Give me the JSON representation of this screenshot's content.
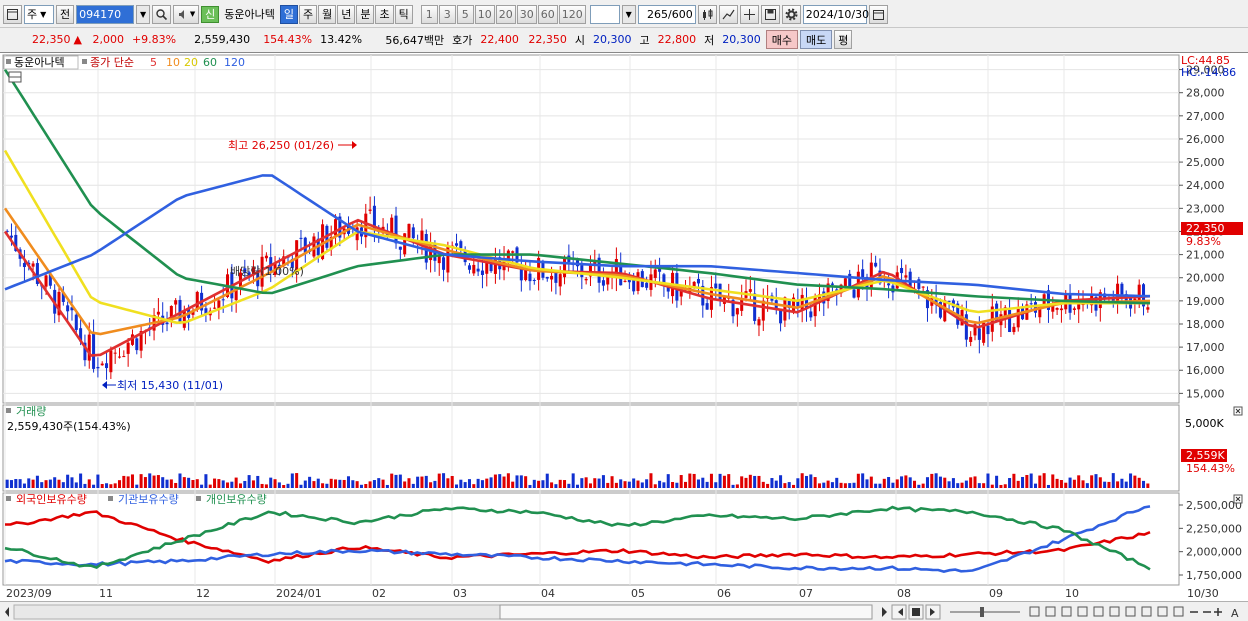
{
  "toolbar": {
    "period_type": "주",
    "prev_label": "전",
    "code": "094170",
    "new_badge": "신",
    "stock_name": "동운아나텍",
    "periods": [
      "일",
      "주",
      "월",
      "년",
      "분",
      "초",
      "틱"
    ],
    "active_period": "일",
    "minutes": [
      "1",
      "3",
      "5",
      "10",
      "20",
      "30",
      "60",
      "120"
    ],
    "count": "265",
    "count_total": "/600",
    "date": "2024/10/30"
  },
  "quote": {
    "price": "22,350",
    "change_arrow": "▲",
    "change": "2,000",
    "change_pct": "+9.83%",
    "volume": "2,559,430",
    "volume_ratio": "154.43%",
    "turnover": "13.42%",
    "trade_value": "56,647백만",
    "ask_label": "호가",
    "ask": "22,400",
    "bid": "22,350",
    "open_label": "시",
    "open": "20,300",
    "high_label": "고",
    "high": "22,800",
    "low_label": "저",
    "low": "20,300",
    "buy_label": "매수",
    "sell_label": "매도",
    "eval_label": "평"
  },
  "legend": {
    "stock": "동운아나텍",
    "ma_title": "종가 단순",
    "ma_periods": [
      "5",
      "10",
      "20",
      "60",
      "120"
    ],
    "lc": "LC:44.85",
    "hc": "HC:-14.86"
  },
  "annotations": {
    "high": "최고 26,250 (01/26)",
    "low": "최저 15,430 (11/01)",
    "dividend": "배당락(1.00%)"
  },
  "price_axis": [
    "29,000",
    "28,000",
    "27,000",
    "26,000",
    "25,000",
    "24,000",
    "23,000",
    "22,000",
    "21,000",
    "20,000",
    "19,000",
    "18,000",
    "17,000",
    "16,000",
    "15,000"
  ],
  "price_tag": {
    "value": "22,350",
    "pct": "9.83%"
  },
  "volume_panel": {
    "title": "거래량",
    "info": "2,559,430주(154.43%)",
    "axis": "5,000K",
    "tag": "2,559K",
    "tag_pct": "154.43%"
  },
  "holding_panel": {
    "titles": [
      "외국인보유수량",
      "기관보유수량",
      "개인보유수량"
    ],
    "axis": [
      "2,500,000",
      "2,250,000",
      "2,000,000",
      "1,750,000"
    ]
  },
  "x_axis": [
    "2023/09",
    "11",
    "12",
    "2024/01",
    "02",
    "03",
    "04",
    "05",
    "06",
    "07",
    "08",
    "09",
    "10",
    "10/30"
  ],
  "colors": {
    "up": "#e00000",
    "down": "#1030d0",
    "ma5": "#e03030",
    "ma10": "#f08c1e",
    "ma20": "#f0e020",
    "ma60": "#209050",
    "ma120": "#3060e0",
    "foreign": "#e00000",
    "institution": "#3060e0",
    "individual": "#209050"
  },
  "chart_data": {
    "type": "line",
    "title": "동운아나텍",
    "ylabel": "",
    "ylim": [
      14800,
      29500
    ],
    "x": [
      "2023/09",
      "11",
      "12",
      "2024/01",
      "02",
      "03",
      "04",
      "05",
      "06",
      "07",
      "08",
      "09",
      "10",
      "10/30"
    ],
    "series": [
      {
        "name": "5",
        "values": [
          22000,
          16500,
          18500,
          20500,
          22500,
          21000,
          20300,
          20200,
          19100,
          18500,
          20300,
          17800,
          19000,
          19200
        ]
      },
      {
        "name": "10",
        "values": [
          23000,
          17500,
          18300,
          20200,
          22300,
          21200,
          20300,
          20100,
          19300,
          18700,
          20100,
          18000,
          18900,
          19000
        ]
      },
      {
        "name": "20",
        "values": [
          25500,
          19000,
          18000,
          19500,
          22000,
          21400,
          20400,
          20000,
          19500,
          19000,
          19900,
          18500,
          18900,
          18900
        ]
      },
      {
        "name": "60",
        "values": [
          29000,
          23000,
          20000,
          19300,
          20500,
          21000,
          21000,
          20600,
          20200,
          19700,
          19500,
          19200,
          19000,
          18900
        ]
      },
      {
        "name": "120",
        "values": [
          19500,
          21000,
          23500,
          24500,
          22000,
          21000,
          20700,
          20500,
          20500,
          20200,
          19900,
          19700,
          19300,
          19200
        ]
      }
    ]
  }
}
